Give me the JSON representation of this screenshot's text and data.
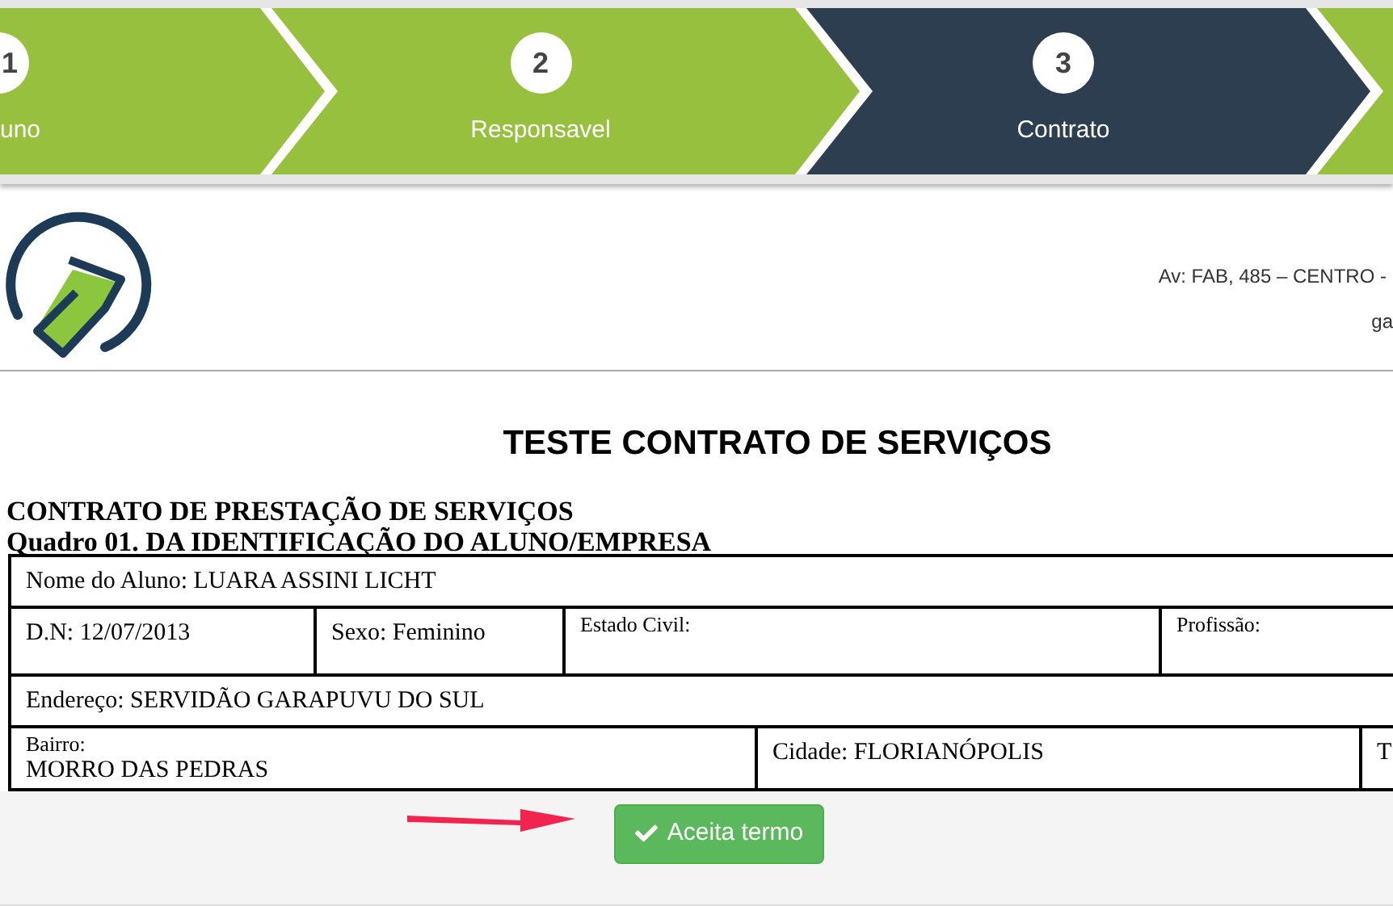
{
  "steps": [
    {
      "number": "1",
      "label": "uno",
      "selected": false
    },
    {
      "number": "2",
      "label": "Responsavel",
      "selected": false
    },
    {
      "number": "3",
      "label": "Contrato",
      "selected": true
    },
    {
      "selected": false
    }
  ],
  "header": {
    "address_lines": [
      "Av: FAB, 485 – CENTRO -",
      "ga"
    ]
  },
  "title": "TESTE CONTRATO DE SERVIÇOS",
  "contract": {
    "heading": "CONTRATO DE PRESTAÇÃO DE SERVIÇOS",
    "section": "Quadro 01. DA IDENTIFICAÇÃO DO ALUNO/EMPRESA",
    "lines": [
      {
        "fields": [
          {
            "text": "Nome do Aluno: LUARA ASSINI LICHT",
            "kind": "inline"
          }
        ]
      },
      {
        "fields": [
          {
            "text": "D.N: 12/07/2013",
            "kind": "inline"
          },
          {
            "text": "Sexo: Feminino",
            "kind": "inline"
          },
          {
            "label": "Estado Civil:",
            "kind": "labeled"
          },
          {
            "label": "Profissão:",
            "kind": "labeled"
          }
        ]
      },
      {
        "fields": [
          {
            "text": "Endereço: SERVIDÃO GARAPUVU DO SUL",
            "kind": "inline"
          }
        ]
      },
      {
        "fields": [
          {
            "label": "Bairro:",
            "value": "MORRO DAS PEDRAS",
            "kind": "labeled"
          },
          {
            "text": "Cidade: FLORIANÓPOLIS",
            "kind": "inline"
          },
          {
            "text": "T",
            "kind": "inline"
          }
        ]
      }
    ]
  },
  "accept_button": "Aceita termo"
}
